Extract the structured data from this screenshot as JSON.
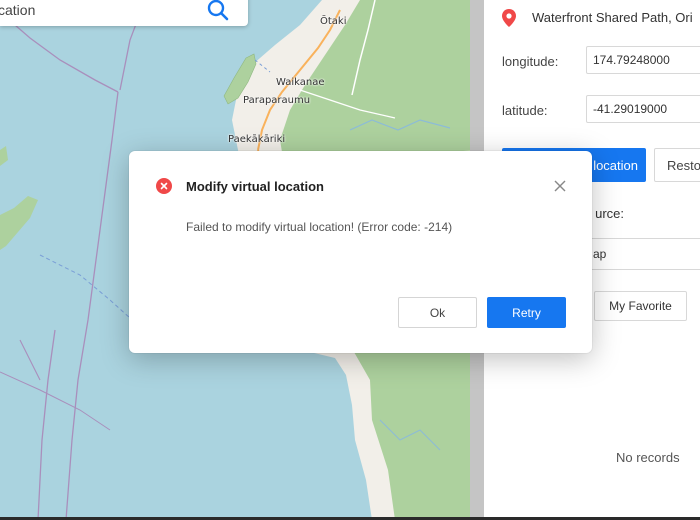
{
  "map": {
    "search": {
      "value": "",
      "placeholder": "cation"
    },
    "labels": {
      "otaki": "Ōtaki",
      "waikanae": "Waikanae",
      "paraparaumu": "Paraparaumu",
      "paekakariki": "Paekākāriki"
    }
  },
  "panel": {
    "location_text": "Waterfront Shared Path, Ori",
    "longitude_label": "longitude:",
    "longitude_value": "174.79248000",
    "latitude_label": "latitude:",
    "latitude_value": "-41.29019000",
    "modify_button": "location",
    "restore_button": "Resto",
    "source_label": "urce:",
    "source_value": "ap",
    "favorite_button": "My Favorite",
    "no_records": "No records"
  },
  "dialog": {
    "title": "Modify virtual location",
    "message": "Failed to modify virtual location! (Error code: -214)",
    "ok_label": "Ok",
    "retry_label": "Retry"
  },
  "colors": {
    "accent": "#1677f0",
    "error": "#f04848",
    "water": "#aad3df",
    "land": "#f2efe9",
    "forest": "#add19e"
  }
}
